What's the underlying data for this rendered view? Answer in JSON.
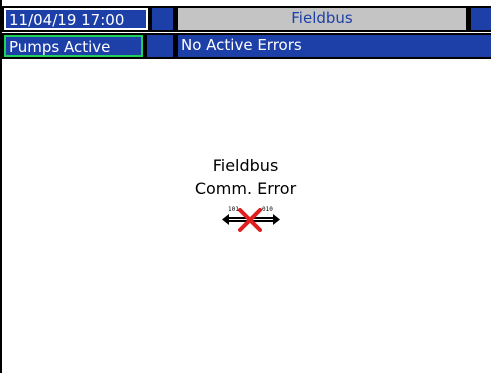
{
  "header": {
    "datetime": "11/04/19 17:00",
    "screen_title": "Fieldbus"
  },
  "status": {
    "pump_state": "Pumps Active",
    "errors": "No Active Errors"
  },
  "main": {
    "message_line1": "Fieldbus",
    "message_line2": "Comm. Error",
    "icon": "comm-error-icon"
  },
  "colors": {
    "bar_blue": "#1c3fa8",
    "title_grey": "#c4c4c4",
    "active_green": "#1fd15a",
    "error_red": "#e01e1e"
  }
}
